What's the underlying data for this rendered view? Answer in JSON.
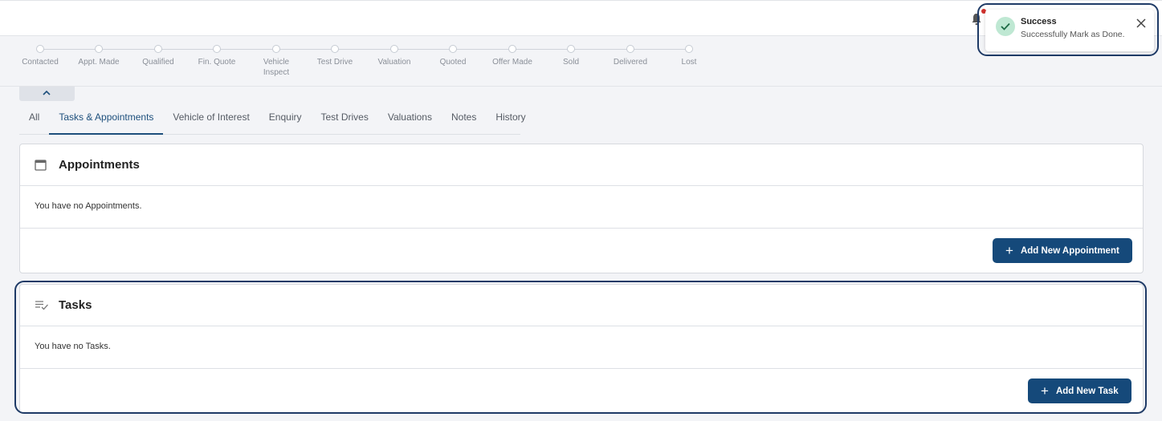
{
  "header": {
    "notification_icon": "bell-icon"
  },
  "stages": [
    {
      "label": "Contacted"
    },
    {
      "label": "Appt. Made"
    },
    {
      "label": "Qualified"
    },
    {
      "label": "Fin. Quote"
    },
    {
      "label": "Vehicle Inspect"
    },
    {
      "label": "Test Drive"
    },
    {
      "label": "Valuation"
    },
    {
      "label": "Quoted"
    },
    {
      "label": "Offer Made"
    },
    {
      "label": "Sold"
    },
    {
      "label": "Delivered"
    },
    {
      "label": "Lost"
    }
  ],
  "tabs": [
    {
      "label": "All"
    },
    {
      "label": "Tasks & Appointments",
      "active": true
    },
    {
      "label": "Vehicle of Interest"
    },
    {
      "label": "Enquiry"
    },
    {
      "label": "Test Drives"
    },
    {
      "label": "Valuations"
    },
    {
      "label": "Notes"
    },
    {
      "label": "History"
    }
  ],
  "appointments": {
    "title": "Appointments",
    "icon": "calendar-icon",
    "empty_text": "You have no Appointments.",
    "button_label": "Add New Appointment"
  },
  "tasks": {
    "title": "Tasks",
    "icon": "task-list-icon",
    "empty_text": "You have no Tasks.",
    "button_label": "Add New Task"
  },
  "toast": {
    "title": "Success",
    "message": "Successfully Mark as Done.",
    "icon": "check-icon"
  },
  "colors": {
    "primary": "#15497a",
    "active_tab": "#1d4f7c",
    "highlight_border": "#1e3a66",
    "success_bg": "#bfe8d3",
    "notification_dot": "#d0312d"
  }
}
